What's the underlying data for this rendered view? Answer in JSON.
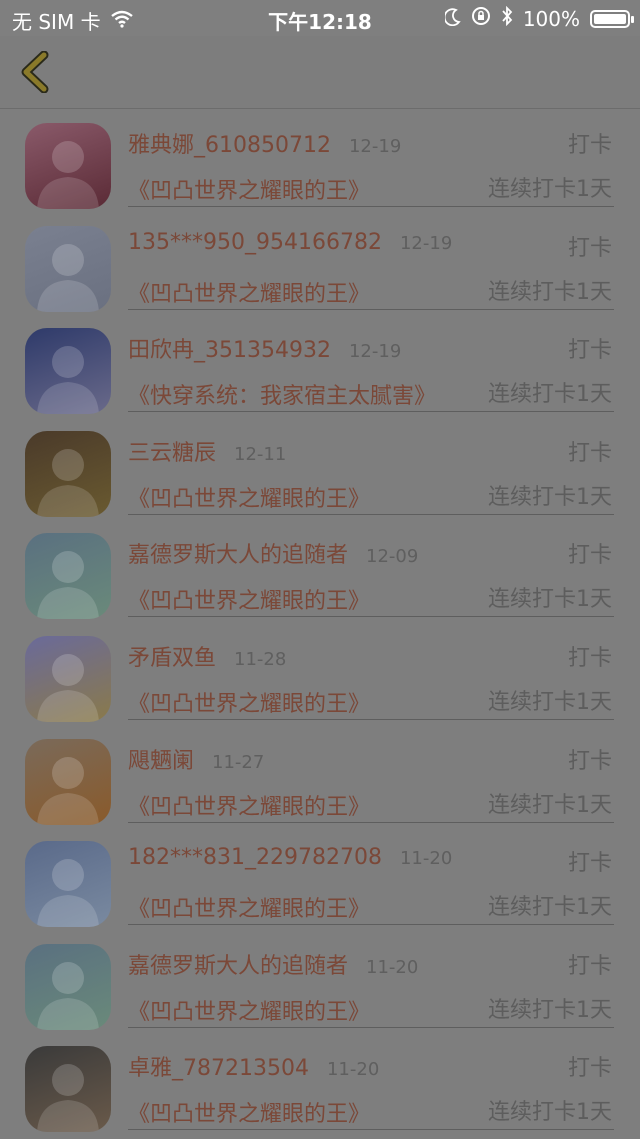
{
  "status_bar": {
    "carrier": "无 SIM 卡",
    "time": "下午12:18",
    "battery": "100%"
  },
  "colors": {
    "accent": "#7b4838",
    "back_icon": "#8a7a2a",
    "overlay_bg": "#7e7e7e"
  },
  "entries": [
    {
      "name": "雅典娜_610850712",
      "date": "12-19",
      "action": "打卡",
      "book": "《凹凸世界之耀眼的王》",
      "streak": "连续打卡1天",
      "avatar": [
        "#8a5a6a",
        "#5a2a35"
      ]
    },
    {
      "name": "135***950_954166782",
      "date": "12-19",
      "action": "打卡",
      "book": "《凹凸世界之耀眼的王》",
      "streak": "连续打卡1天",
      "avatar": [
        "#7a8090",
        "#6a7080"
      ]
    },
    {
      "name": "田欣冉_351354932",
      "date": "12-19",
      "action": "打卡",
      "book": "《快穿系统：我家宿主太腻害》",
      "streak": "连续打卡1天",
      "avatar": [
        "#2e3a6a",
        "#6a6a8a"
      ]
    },
    {
      "name": "三云糖辰",
      "date": "12-11",
      "action": "打卡",
      "book": "《凹凸世界之耀眼的王》",
      "streak": "连续打卡1天",
      "avatar": [
        "#4a3a2a",
        "#6a5a30"
      ]
    },
    {
      "name": "嘉德罗斯大人的追随者",
      "date": "12-09",
      "action": "打卡",
      "book": "《凹凸世界之耀眼的王》",
      "streak": "连续打卡1天",
      "avatar": [
        "#5a7080",
        "#6a8a7a"
      ]
    },
    {
      "name": "矛盾双鱼",
      "date": "11-28",
      "action": "打卡",
      "book": "《凹凸世界之耀眼的王》",
      "streak": "连续打卡1天",
      "avatar": [
        "#6a6a9a",
        "#8a7a4a"
      ]
    },
    {
      "name": "飓魉阑",
      "date": "11-27",
      "action": "打卡",
      "book": "《凹凸世界之耀眼的王》",
      "streak": "连续打卡1天",
      "avatar": [
        "#7a6a5a",
        "#8a5a2a"
      ]
    },
    {
      "name": "182***831_229782708",
      "date": "11-20",
      "action": "打卡",
      "book": "《凹凸世界之耀眼的王》",
      "streak": "连续打卡1天",
      "avatar": [
        "#5a6a8a",
        "#7a8aa0"
      ]
    },
    {
      "name": "嘉德罗斯大人的追随者",
      "date": "11-20",
      "action": "打卡",
      "book": "《凹凸世界之耀眼的王》",
      "streak": "连续打卡1天",
      "avatar": [
        "#5a7080",
        "#6a8a7a"
      ]
    },
    {
      "name": "卓雅_787213504",
      "date": "11-20",
      "action": "打卡",
      "book": "《凹凸世界之耀眼的王》",
      "streak": "连续打卡1天",
      "avatar": [
        "#3a3a3a",
        "#6a5a4a"
      ]
    }
  ]
}
